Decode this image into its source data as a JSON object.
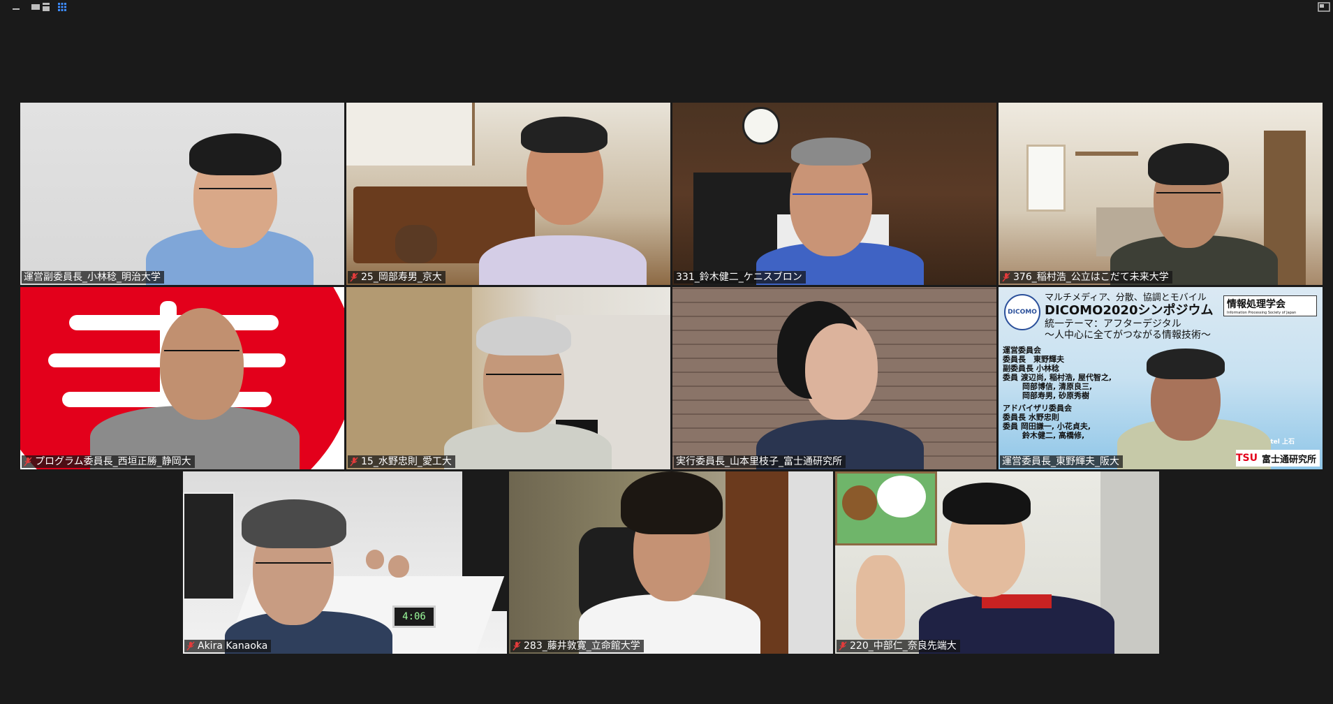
{
  "toolbar": {
    "buttons": [
      {
        "icon": "minimize-icon"
      },
      {
        "icon": "speaker-view-icon"
      },
      {
        "icon": "strip-view-icon"
      },
      {
        "icon": "gallery-view-icon"
      }
    ],
    "corner_icon": "exit-fullscreen-icon"
  },
  "participants": [
    {
      "name": "運営副委員長_小林稔_明治大学",
      "muted": false
    },
    {
      "name": "25_岡部寿男_京大",
      "muted": true
    },
    {
      "name": "331_鈴木健二_ケニスブロン",
      "muted": false
    },
    {
      "name": "376_稲村浩_公立はこだて未来大学",
      "muted": true
    },
    {
      "name": "プログラム委員長_西垣正勝_静岡大",
      "muted": true
    },
    {
      "name": "15_水野忠則_愛工大",
      "muted": true
    },
    {
      "name": "実行委員長_山本里枝子_富士通研究所",
      "muted": false
    },
    {
      "name": "運営委員長_東野輝夫_阪大",
      "muted": false
    },
    {
      "name": "Akira Kanaoka",
      "muted": true
    },
    {
      "name": "283_藤井敦寛_立命館大学",
      "muted": true
    },
    {
      "name": "220_中部仁_奈良先端大",
      "muted": true
    }
  ],
  "virtual_background": {
    "title_line": "マルチメディア、分散、協調とモバイル",
    "title": "DICOMO2020シンポジウム",
    "theme": "統一テーマ：アフターデジタル",
    "subtitle": "～人中心に全てがつながる情報技術～",
    "org": "情報処理学会",
    "org_sub": "Information Processing Society of Japan",
    "logo_text": "DICOMO",
    "lines": [
      "運営委員会",
      "委員長　東野輝夫",
      "副委員長 小林稔",
      "委員 渡辺尚, 稲村浩, 屋代智之,",
      "岡部博信, 清原良三,",
      "岡部寿男, 砂原秀樹",
      "アドバイザリ委員会",
      "委員長 水野忠則",
      "委員 岡田謙一, 小花貞夫,",
      "鈴木健二, 高橋修,"
    ],
    "sponsor": "富士通研究所",
    "sponsor_prefix": "TSU",
    "map_labels": [
      "Royal Hotel 上石"
    ]
  },
  "clock_reading": "4:06"
}
